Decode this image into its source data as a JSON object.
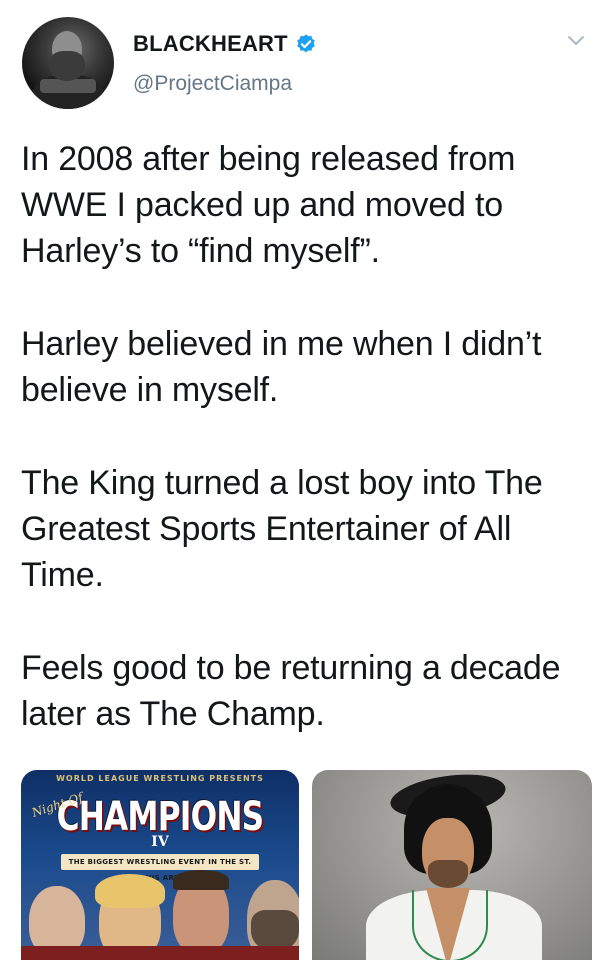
{
  "tweet": {
    "author": {
      "display_name": "BLACKHEART",
      "handle": "@ProjectCiampa",
      "verified": true,
      "verified_color": "#1da1f2"
    },
    "menu_icon": "chevron-down-icon",
    "paragraphs": [
      "In 2008 after being released from WWE I packed up and moved to Harley’s to “find myself”.",
      "Harley believed in me when I didn’t believe in myself.",
      "The King turned a lost boy into The Greatest Sports Entertainer of All Time.",
      "Feels good to be returning a decade later as The Champ."
    ],
    "media": {
      "poster": {
        "top_text": "WORLD LEAGUE WRESTLING PRESENTS",
        "night_of": "Night Of",
        "title": "CHAMPIONS",
        "numeral": "IV",
        "tagline": "THE BIGGEST WRESTLING EVENT IN THE ST. LOUIS AREA"
      }
    }
  },
  "colors": {
    "text": "#14171a",
    "secondary": "#657786",
    "background": "#ffffff"
  }
}
